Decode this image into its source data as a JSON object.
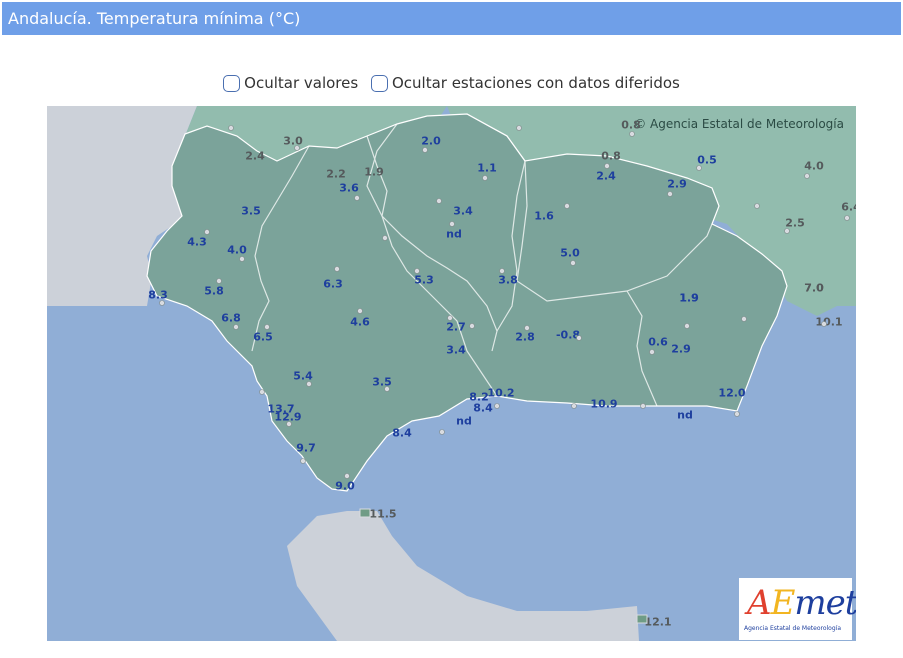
{
  "header": {
    "title": "Andalucía. Temperatura mínima (°C)"
  },
  "options": {
    "hide_values": "Ocultar valores",
    "hide_deferred": "Ocultar estaciones con datos diferidos"
  },
  "map": {
    "attribution": "© Agencia Estatal de Meteorología",
    "logo_text": "AEmet",
    "logo_subtitle": "Agencia Estatal de Meteorología",
    "colors": {
      "sea": "#90aed6",
      "andalucia": "#7ba39a",
      "other_regions": "#92bcae",
      "africa": "#ccd1d9",
      "portugal": "#ccd1d9"
    },
    "stations_andalucia": [
      "2.0",
      "1.1",
      "0.8",
      "0.5",
      "2.4",
      "2.9",
      "3.4",
      "1.6",
      "nd",
      "5.0",
      "3.8",
      "5.3",
      "1.9",
      "3.5",
      "3.6",
      "2.2",
      "1.9",
      "4.3",
      "4.0",
      "6.3",
      "5.8",
      "8.3",
      "6.8",
      "6.5",
      "4.6",
      "2.7",
      "3.4",
      "2.8",
      "-0.8",
      "0.6",
      "2.9",
      "1.9",
      "7.0",
      "12.0",
      "nd",
      "10.9",
      "10.2",
      "8.2",
      "8.4",
      "nd",
      "8.4",
      "3.5",
      "5.4",
      "13.7",
      "12.9",
      "9.7",
      "9.0"
    ],
    "stations_outside": [
      "0.8",
      "3.0",
      "2.4",
      "4.0",
      "6.4",
      "2.5",
      "7.0",
      "10.1",
      "11.5",
      "12.1"
    ]
  }
}
